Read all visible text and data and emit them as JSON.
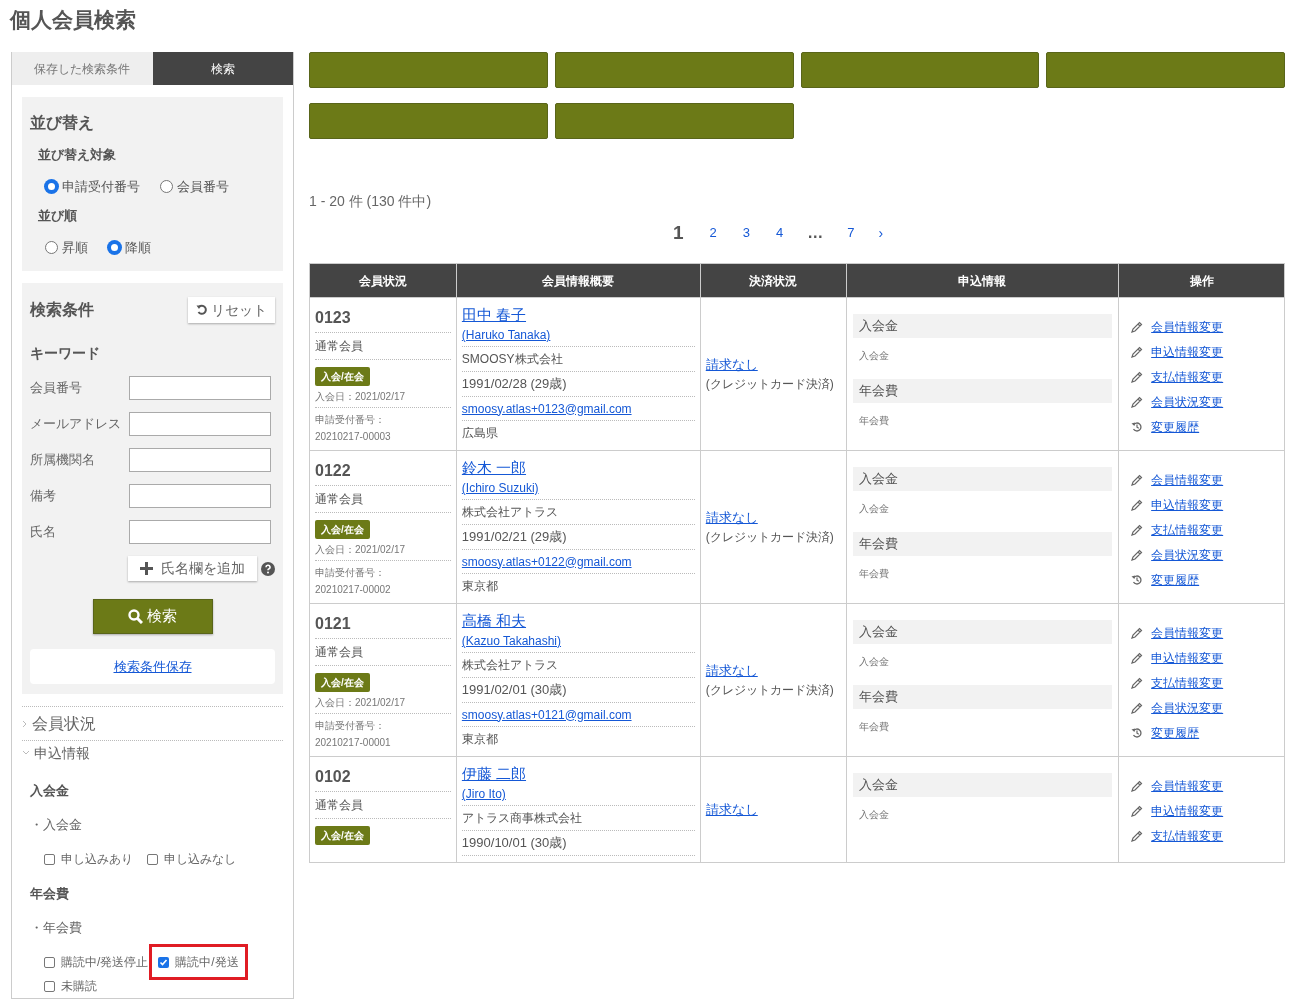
{
  "page_title": "個人会員検索",
  "sidebar": {
    "tabs": [
      {
        "label": "保存した検索条件",
        "selected": false
      },
      {
        "label": "検索",
        "selected": true
      }
    ],
    "sort": {
      "title": "並び替え",
      "groups": [
        {
          "label": "並び替え対象",
          "options": [
            {
              "label": "申請受付番号",
              "selected": true
            },
            {
              "label": "会員番号",
              "selected": false
            }
          ]
        },
        {
          "label": "並び順",
          "options": [
            {
              "label": "昇順",
              "selected": false
            },
            {
              "label": "降順",
              "selected": true
            }
          ]
        }
      ]
    },
    "search": {
      "title": "検索条件",
      "reset_button": "リセット",
      "keyword_label": "キーワード",
      "fields": [
        {
          "label": "会員番号"
        },
        {
          "label": "メールアドレス"
        },
        {
          "label": "所属機関名"
        },
        {
          "label": "備考"
        },
        {
          "label": "氏名"
        }
      ],
      "add_name_button": "氏名欄を追加",
      "search_button": "検索",
      "save_link": "検索条件保存"
    },
    "sections": [
      {
        "label": "会員状況",
        "expanded": false
      },
      {
        "label": "申込情報",
        "expanded": true
      }
    ],
    "filters": [
      {
        "heading": "入会金",
        "subheading": "・入会金",
        "options": [
          {
            "label": "申し込みあり",
            "checked": false,
            "highlighted": false
          },
          {
            "label": "申し込みなし",
            "checked": false,
            "highlighted": false
          }
        ]
      },
      {
        "heading": "年会費",
        "subheading": "・年会費",
        "options": [
          {
            "label": "購読中/発送停止",
            "checked": false,
            "highlighted": false
          },
          {
            "label": "購読中/発送",
            "checked": true,
            "highlighted": true
          },
          {
            "label": "未購読",
            "checked": false,
            "highlighted": false
          }
        ]
      }
    ]
  },
  "toolbar_buttons": [
    {
      "kind": "button"
    },
    {
      "kind": "button"
    },
    {
      "kind": "button"
    },
    {
      "kind": "button"
    },
    {
      "kind": "button"
    },
    {
      "kind": "button"
    }
  ],
  "result_count": "1 - 20 件 (130 件中)",
  "pagination": [
    {
      "label": "1",
      "kind": "page",
      "selected": true
    },
    {
      "label": "2",
      "kind": "page",
      "selected": false
    },
    {
      "label": "3",
      "kind": "page",
      "selected": false
    },
    {
      "label": "4",
      "kind": "page",
      "selected": false
    },
    {
      "label": "…",
      "kind": "ellipsis"
    },
    {
      "label": "7",
      "kind": "page",
      "selected": false
    },
    {
      "label": "›",
      "kind": "next"
    }
  ],
  "table": {
    "columns": [
      "会員状況",
      "会員情報概要",
      "決済状況",
      "申込情報",
      "操作"
    ],
    "rows": [
      {
        "member_no": "0123",
        "member_type": "通常会員",
        "status_badge": "入会/在会",
        "joined": "入会日：2021/02/17",
        "application_label": "申請受付番号：",
        "application_no": "20210217-00003",
        "name": "田中 春子",
        "name_roman": "(Haruko Tanaka)",
        "company": "SMOOSY株式会社",
        "birth": "1991/02/28 (29歳)",
        "email": "smoosy.atlas+0123@gmail.com",
        "prefecture": "広島県",
        "payment": "請求なし",
        "payment_method": "(クレジットカード決済)",
        "application_info": [
          {
            "heading": "入会金",
            "detail": "入会金"
          },
          {
            "heading": "年会費",
            "detail": "年会費"
          }
        ],
        "actions": [
          {
            "kind": "edit",
            "label": "会員情報変更"
          },
          {
            "kind": "edit",
            "label": "申込情報変更"
          },
          {
            "kind": "edit",
            "label": "支払情報変更"
          },
          {
            "kind": "edit",
            "label": "会員状況変更"
          },
          {
            "kind": "history",
            "label": "変更履歴"
          }
        ]
      },
      {
        "member_no": "0122",
        "member_type": "通常会員",
        "status_badge": "入会/在会",
        "joined": "入会日：2021/02/17",
        "application_label": "申請受付番号：",
        "application_no": "20210217-00002",
        "name": "鈴木 一郎",
        "name_roman": "(Ichiro Suzuki)",
        "company": "株式会社アトラス",
        "birth": "1991/02/21 (29歳)",
        "email": "smoosy.atlas+0122@gmail.com",
        "prefecture": "東京都",
        "payment": "請求なし",
        "payment_method": "(クレジットカード決済)",
        "application_info": [
          {
            "heading": "入会金",
            "detail": "入会金"
          },
          {
            "heading": "年会費",
            "detail": "年会費"
          }
        ],
        "actions": [
          {
            "kind": "edit",
            "label": "会員情報変更"
          },
          {
            "kind": "edit",
            "label": "申込情報変更"
          },
          {
            "kind": "edit",
            "label": "支払情報変更"
          },
          {
            "kind": "edit",
            "label": "会員状況変更"
          },
          {
            "kind": "history",
            "label": "変更履歴"
          }
        ]
      },
      {
        "member_no": "0121",
        "member_type": "通常会員",
        "status_badge": "入会/在会",
        "joined": "入会日：2021/02/17",
        "application_label": "申請受付番号：",
        "application_no": "20210217-00001",
        "name": "高橋 和夫",
        "name_roman": "(Kazuo Takahashi)",
        "company": "株式会社アトラス",
        "birth": "1991/02/01 (30歳)",
        "email": "smoosy.atlas+0121@gmail.com",
        "prefecture": "東京都",
        "payment": "請求なし",
        "payment_method": "(クレジットカード決済)",
        "application_info": [
          {
            "heading": "入会金",
            "detail": "入会金"
          },
          {
            "heading": "年会費",
            "detail": "年会費"
          }
        ],
        "actions": [
          {
            "kind": "edit",
            "label": "会員情報変更"
          },
          {
            "kind": "edit",
            "label": "申込情報変更"
          },
          {
            "kind": "edit",
            "label": "支払情報変更"
          },
          {
            "kind": "edit",
            "label": "会員状況変更"
          },
          {
            "kind": "history",
            "label": "変更履歴"
          }
        ]
      },
      {
        "member_no": "0102",
        "member_type": "通常会員",
        "status_badge": "入会/在会",
        "name": "伊藤 二郎",
        "name_roman": "(Jiro Ito)",
        "company": "アトラス商事株式会社",
        "birth": "1990/10/01 (30歳)",
        "payment": "請求なし",
        "application_info": [
          {
            "heading": "入会金",
            "detail": "入会金"
          }
        ],
        "actions": [
          {
            "kind": "edit",
            "label": "会員情報変更"
          },
          {
            "kind": "edit",
            "label": "申込情報変更"
          },
          {
            "kind": "edit",
            "label": "支払情報変更"
          }
        ]
      }
    ]
  }
}
